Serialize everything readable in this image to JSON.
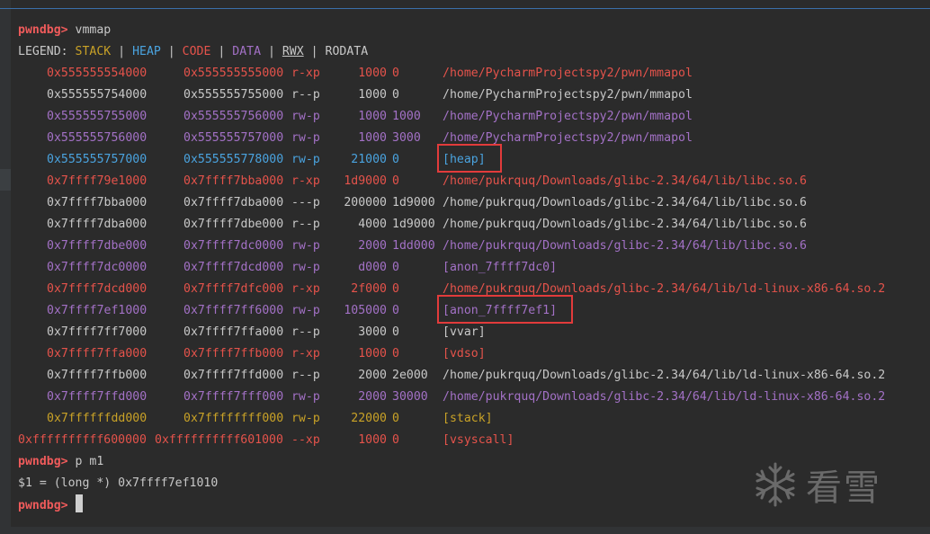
{
  "prompt": "pwndbg>",
  "commands": {
    "vmmap": "vmmap",
    "print": "p m1"
  },
  "legend": {
    "label": "LEGEND:",
    "stack": "STACK",
    "heap": "HEAP",
    "code": "CODE",
    "data": "DATA",
    "rwx": "RWX",
    "rodata": "RODATA"
  },
  "mappings": [
    {
      "start": "0x555555554000",
      "end": "0x555555555000",
      "perm": "r-xp",
      "size": "1000",
      "offset": "0",
      "obj": "/home/PycharmProjectspy2/pwn/mmapol",
      "kind": "code"
    },
    {
      "start": "0x555555754000",
      "end": "0x555555755000",
      "perm": "r--p",
      "size": "1000",
      "offset": "0",
      "obj": "/home/PycharmProjectspy2/pwn/mmapol",
      "kind": "ro"
    },
    {
      "start": "0x555555755000",
      "end": "0x555555756000",
      "perm": "rw-p",
      "size": "1000",
      "offset": "1000",
      "obj": "/home/PycharmProjectspy2/pwn/mmapol",
      "kind": "data"
    },
    {
      "start": "0x555555756000",
      "end": "0x555555757000",
      "perm": "rw-p",
      "size": "1000",
      "offset": "3000",
      "obj": "/home/PycharmProjectspy2/pwn/mmapol",
      "kind": "data"
    },
    {
      "start": "0x555555757000",
      "end": "0x555555778000",
      "perm": "rw-p",
      "size": "21000",
      "offset": "0",
      "obj": "[heap]",
      "kind": "heap"
    },
    {
      "start": "0x7ffff79e1000",
      "end": "0x7ffff7bba000",
      "perm": "r-xp",
      "size": "1d9000",
      "offset": "0",
      "obj": "/home/pukrquq/Downloads/glibc-2.34/64/lib/libc.so.6",
      "kind": "code"
    },
    {
      "start": "0x7ffff7bba000",
      "end": "0x7ffff7dba000",
      "perm": "---p",
      "size": "200000",
      "offset": "1d9000",
      "obj": "/home/pukrquq/Downloads/glibc-2.34/64/lib/libc.so.6",
      "kind": "ro"
    },
    {
      "start": "0x7ffff7dba000",
      "end": "0x7ffff7dbe000",
      "perm": "r--p",
      "size": "4000",
      "offset": "1d9000",
      "obj": "/home/pukrquq/Downloads/glibc-2.34/64/lib/libc.so.6",
      "kind": "ro"
    },
    {
      "start": "0x7ffff7dbe000",
      "end": "0x7ffff7dc0000",
      "perm": "rw-p",
      "size": "2000",
      "offset": "1dd000",
      "obj": "/home/pukrquq/Downloads/glibc-2.34/64/lib/libc.so.6",
      "kind": "data"
    },
    {
      "start": "0x7ffff7dc0000",
      "end": "0x7ffff7dcd000",
      "perm": "rw-p",
      "size": "d000",
      "offset": "0",
      "obj": "[anon_7ffff7dc0]",
      "kind": "data"
    },
    {
      "start": "0x7ffff7dcd000",
      "end": "0x7ffff7dfc000",
      "perm": "r-xp",
      "size": "2f000",
      "offset": "0",
      "obj": "/home/pukrquq/Downloads/glibc-2.34/64/lib/ld-linux-x86-64.so.2",
      "kind": "code"
    },
    {
      "start": "0x7ffff7ef1000",
      "end": "0x7ffff7ff6000",
      "perm": "rw-p",
      "size": "105000",
      "offset": "0",
      "obj": "[anon_7ffff7ef1]",
      "kind": "data"
    },
    {
      "start": "0x7ffff7ff7000",
      "end": "0x7ffff7ffa000",
      "perm": "r--p",
      "size": "3000",
      "offset": "0",
      "obj": "[vvar]",
      "kind": "ro"
    },
    {
      "start": "0x7ffff7ffa000",
      "end": "0x7ffff7ffb000",
      "perm": "r-xp",
      "size": "1000",
      "offset": "0",
      "obj": "[vdso]",
      "kind": "code"
    },
    {
      "start": "0x7ffff7ffb000",
      "end": "0x7ffff7ffd000",
      "perm": "r--p",
      "size": "2000",
      "offset": "2e000",
      "obj": "/home/pukrquq/Downloads/glibc-2.34/64/lib/ld-linux-x86-64.so.2",
      "kind": "ro"
    },
    {
      "start": "0x7ffff7ffd000",
      "end": "0x7ffff7fff000",
      "perm": "rw-p",
      "size": "2000",
      "offset": "30000",
      "obj": "/home/pukrquq/Downloads/glibc-2.34/64/lib/ld-linux-x86-64.so.2",
      "kind": "data"
    },
    {
      "start": "0x7ffffffdd000",
      "end": "0x7ffffffff000",
      "perm": "rw-p",
      "size": "22000",
      "offset": "0",
      "obj": "[stack]",
      "kind": "stack"
    },
    {
      "start": "0xffffffffff600000",
      "end": "0xffffffffff601000",
      "perm": "--xp",
      "size": "1000",
      "offset": "0",
      "obj": "[vsyscall]",
      "kind": "code",
      "wide": true
    }
  ],
  "print_result": "$1 = (long *) 0x7ffff7ef1010",
  "highlighted_objects": [
    "[heap]",
    "[anon_7ffff7ef1]"
  ],
  "watermark": {
    "icon": "snowflake-icon",
    "text": "看雪"
  },
  "colors": {
    "stack": "#c9a227",
    "heap": "#4aa3df",
    "code": "#e5534b",
    "data": "#a371c6",
    "ro": "#c8c8c8",
    "prompt": "#f05b5b",
    "highlight_box": "#e23b3b",
    "background": "#2b2b2b"
  }
}
